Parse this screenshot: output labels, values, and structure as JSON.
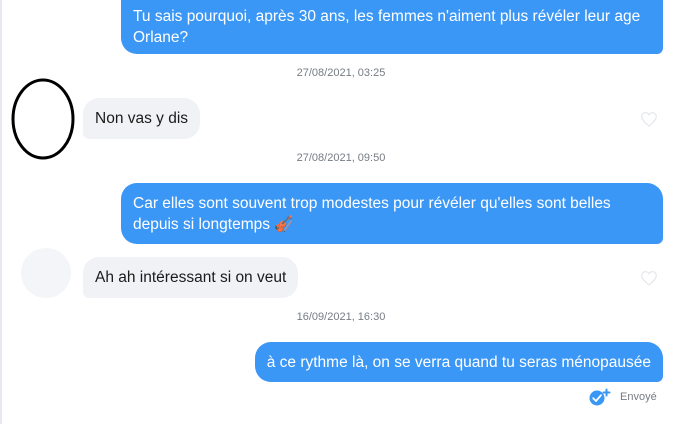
{
  "messages": [
    {
      "direction": "outgoing",
      "text": "Tu sais pourquoi, après 30 ans, les femmes n'aiment plus révéler leur age Orlane?"
    },
    {
      "direction": "timestamp",
      "text": "27/08/2021, 03:25"
    },
    {
      "direction": "incoming",
      "text": "Non vas y dis"
    },
    {
      "direction": "timestamp",
      "text": "27/08/2021, 09:50"
    },
    {
      "direction": "outgoing",
      "text": "Car elles sont souvent trop modestes pour révéler qu'elles sont belles depuis si longtemps 🎻"
    },
    {
      "direction": "incoming",
      "text": "Ah ah intéressant si on veut"
    },
    {
      "direction": "timestamp",
      "text": "16/09/2021, 16:30"
    },
    {
      "direction": "outgoing",
      "text": "à ce rythme là, on se verra quand tu seras ménopausée"
    }
  ],
  "delivery": {
    "label": "Envoyé",
    "icon": "double-check-icon"
  },
  "icons": {
    "like": "heart-outline-icon"
  },
  "colors": {
    "outgoing_bubble": "#3b97f5",
    "incoming_bubble": "#f0f2f5",
    "accent": "#3b97f5"
  }
}
